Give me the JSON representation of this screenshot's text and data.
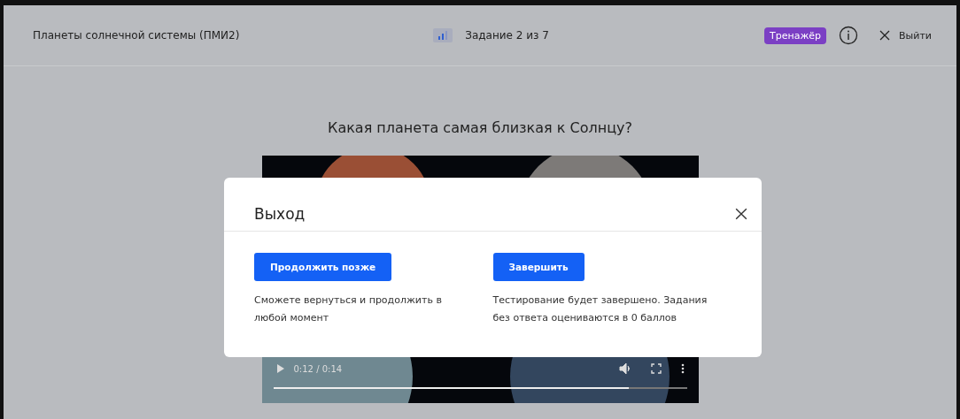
{
  "header": {
    "title": "Планеты солнечной системы (ПМИ2)",
    "progress": "Задание 2 из 7",
    "badge": "Тренажёр",
    "exit": "Выйти"
  },
  "question": "Какая планета самая близкая к Солнцу?",
  "video": {
    "time": "0:12 / 0:14",
    "level": 0.86
  },
  "dialog": {
    "title": "Выход",
    "options": [
      {
        "button": "Продолжить позже",
        "description": "Сможете вернуться и продолжить в любой момент"
      },
      {
        "button": "Завершить",
        "description": "Тестирование будет завершено. Задания без ответа оцениваются в 0 баллов"
      }
    ]
  }
}
